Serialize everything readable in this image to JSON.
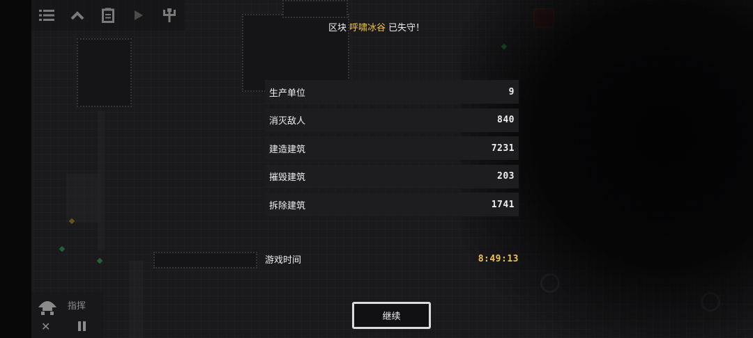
{
  "header": {
    "prefix": "区块",
    "sector_name": "呼啸冰谷",
    "suffix": "已失守！"
  },
  "stats": [
    {
      "label": "生产单位",
      "value": "9"
    },
    {
      "label": "消灭敌人",
      "value": "840"
    },
    {
      "label": "建造建筑",
      "value": "7231"
    },
    {
      "label": "摧毁建筑",
      "value": "203"
    },
    {
      "label": "拆除建筑",
      "value": "1741"
    }
  ],
  "playtime": {
    "label": "游戏时间",
    "value": "8:49:13"
  },
  "continue_button": {
    "label": "继续"
  },
  "toolbar": {
    "icons": [
      "menu-icon",
      "chevron-up-icon",
      "clipboard-icon",
      "play-icon",
      "tree-icon"
    ]
  },
  "command_panel": {
    "label": "指挥"
  },
  "colors": {
    "accent": "#f3c24a",
    "panel": "#1d1d20",
    "background": "#2a2a2e"
  }
}
